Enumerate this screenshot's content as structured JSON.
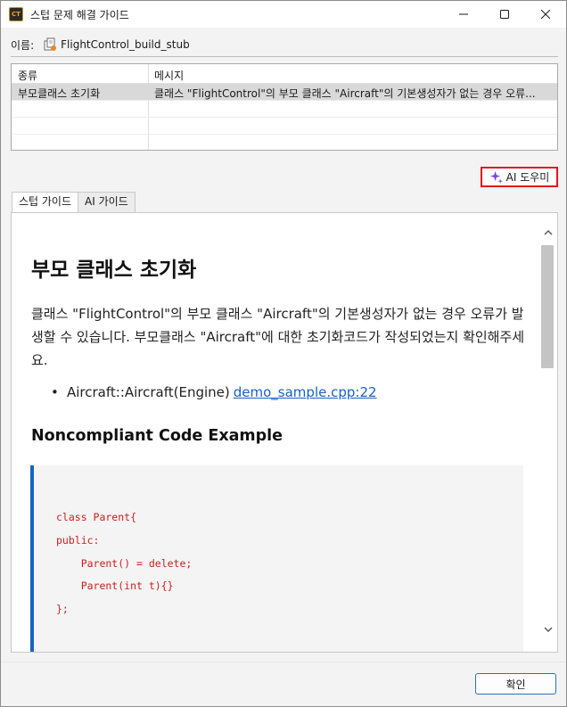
{
  "window": {
    "app_icon_text": "CT",
    "title": "스텁 문제 해결 가이드"
  },
  "name_row": {
    "label": "이름:",
    "value": "FlightControl_build_stub"
  },
  "table": {
    "columns": [
      "종류",
      "메시지"
    ],
    "rows": [
      {
        "type": "부모클래스 초기화",
        "message": "클래스 \"FlightControl\"의 부모 클래스 \"Aircraft\"의 기본생성자가 없는 경우 오류..."
      }
    ]
  },
  "ai_button": {
    "label": "AI 도우미",
    "icon": "sparkle-icon",
    "accent_color": "#7b3fe4"
  },
  "tabs": [
    {
      "label": "스텁 가이드",
      "active": true
    },
    {
      "label": "AI 가이드",
      "active": false
    }
  ],
  "guide": {
    "title": "부모 클래스 초기화",
    "paragraph": "클래스 \"FlightControl\"의 부모 클래스 \"Aircraft\"의 기본생성자가 없는 경우 오류가 발생할 수 있습니다. 부모클래스 \"Aircraft\"에 대한 초기화코드가 작성되었는지 확인해주세요.",
    "bullet_text": "Aircraft::Aircraft(Engine)",
    "bullet_link": "demo_sample.cpp:22",
    "section_heading": "Noncompliant Code Example",
    "code_lines": [
      "class Parent{",
      "public:",
      "    Parent() = delete;",
      "    Parent(int t){}",
      "};"
    ]
  },
  "footer": {
    "ok_label": "확인"
  },
  "colors": {
    "link": "#1a5fc8",
    "code_text": "#cc1f1f",
    "code_accent_bar": "#1565c0",
    "ai_button_border": "#e0191c"
  }
}
